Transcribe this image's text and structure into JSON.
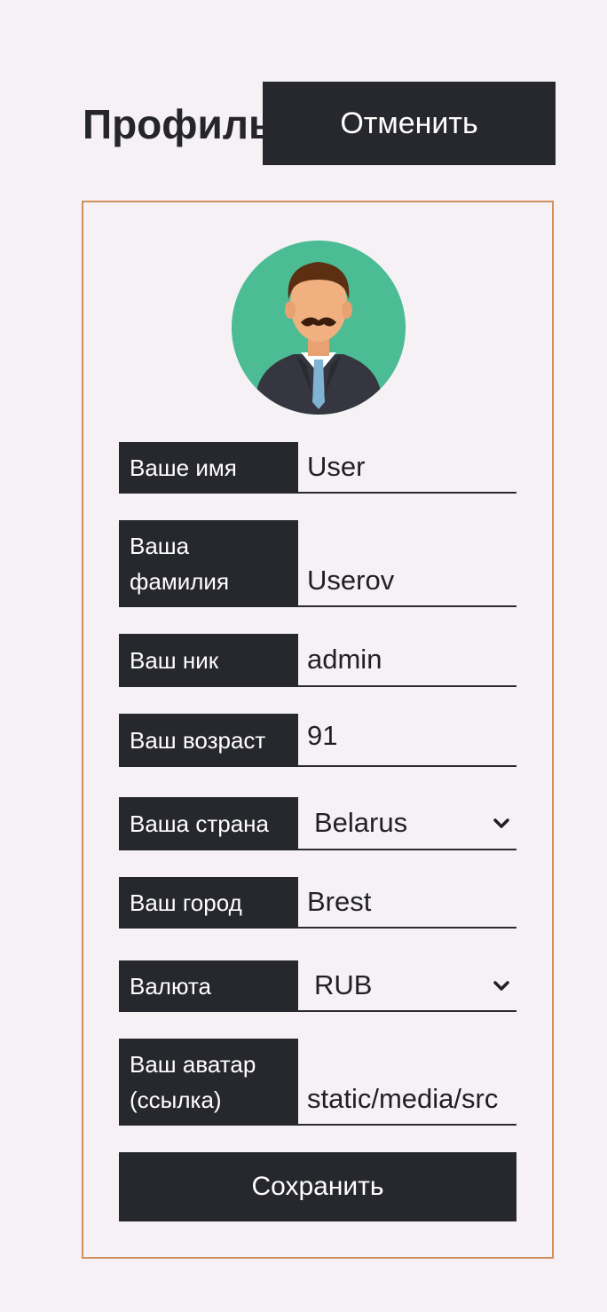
{
  "header": {
    "title": "Профиль",
    "cancel_label": "Отменить"
  },
  "avatar": {
    "icon": "user-avatar-icon"
  },
  "form": {
    "first_name": {
      "label": "Ваше имя",
      "value": "User"
    },
    "last_name": {
      "label": "Ваша фамилия",
      "value": "Userov"
    },
    "nickname": {
      "label": "Ваш ник",
      "value": "admin"
    },
    "age": {
      "label": "Ваш возраст",
      "value": "91"
    },
    "country": {
      "label": "Ваша страна",
      "value": "Belarus"
    },
    "city": {
      "label": "Ваш город",
      "value": "Brest"
    },
    "currency": {
      "label": "Валюта",
      "value": "RUB"
    },
    "avatar_link": {
      "label": "Ваш аватар (ссылка)",
      "value": "static/media/src"
    }
  },
  "save_label": "Сохранить",
  "colors": {
    "background": "#f6f1f5",
    "dark": "#27282e",
    "card_border": "#d18f5e",
    "avatar_bg": "#4cbc95"
  }
}
